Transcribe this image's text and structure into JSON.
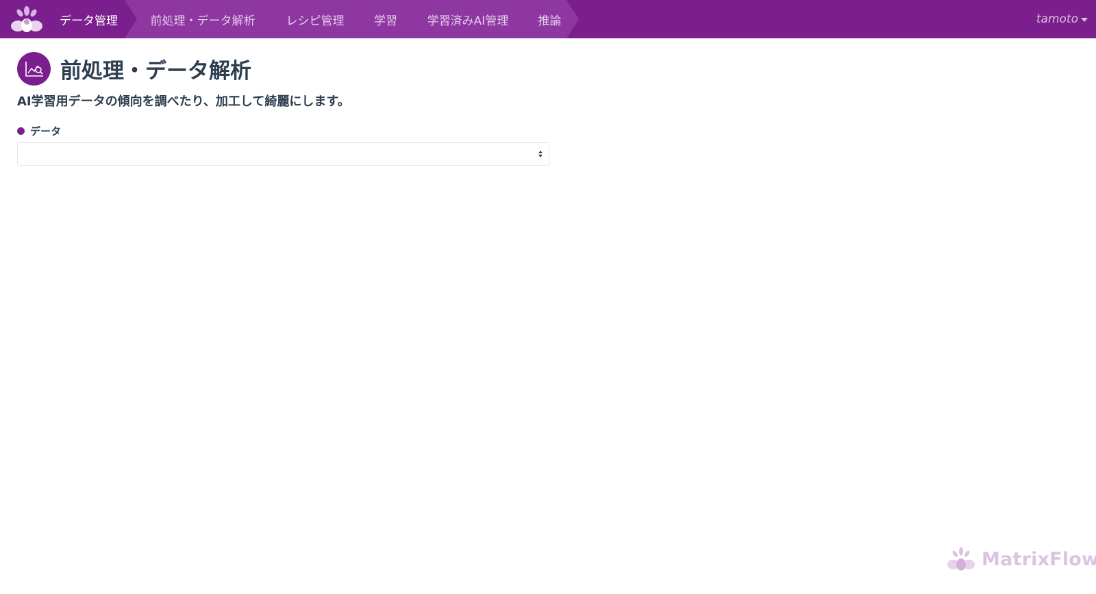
{
  "nav": {
    "steps": [
      {
        "label": "データ管理"
      },
      {
        "label": "前処理・データ解析"
      },
      {
        "label": "レシピ管理"
      },
      {
        "label": "学習"
      },
      {
        "label": "学習済みAI管理"
      },
      {
        "label": "推論"
      }
    ],
    "user": "tamoto",
    "brand_icon": "matrixflow-flower-logo"
  },
  "page": {
    "icon": "chart-search-icon",
    "title": "前処理・データ解析",
    "description": "AI学習用データの傾向を調べたり、加工して綺麗にします。"
  },
  "form": {
    "data_label": "データ",
    "data_select_value": ""
  },
  "watermark": {
    "text": "MatrixFlow"
  },
  "colors": {
    "brand": "#7b1f8e",
    "nav_step_inactive": "#8e37a1",
    "text": "#2c3e50",
    "watermark": "#dcc3e3"
  }
}
